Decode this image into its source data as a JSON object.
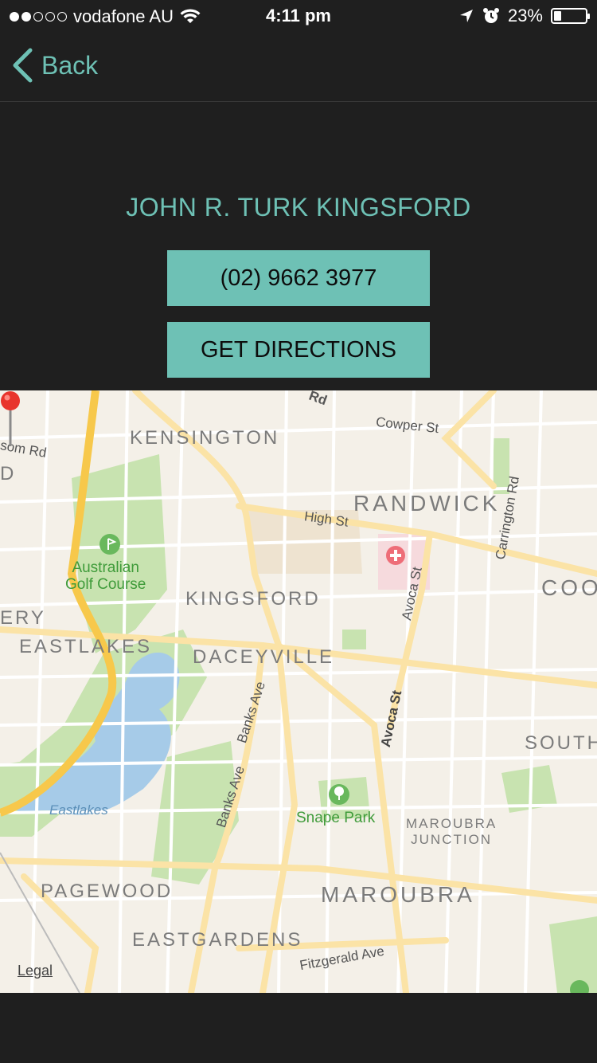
{
  "status_bar": {
    "carrier": "vodafone AU",
    "time": "4:11 pm",
    "battery": "23%",
    "battery_level": 0.23,
    "signal_bars_filled": 2,
    "signal_bars_total": 5
  },
  "nav": {
    "back_label": "Back"
  },
  "place": {
    "name": "JOHN R. TURK KINGSFORD",
    "phone": "(02) 9662 3977",
    "directions_label": "GET DIRECTIONS"
  },
  "map": {
    "suburbs": {
      "kensington": "KENSINGTON",
      "randwick": "RANDWICK",
      "kingsford": "KINGSFORD",
      "daceyville": "DACEYVILLE",
      "eastlakes": "EASTLAKES",
      "pagewood": "PAGEWOOD",
      "eastgardens": "EASTGARDENS",
      "maroubra": "MAROUBRA",
      "maroubra_junction_1": "MAROUBRA",
      "maroubra_junction_2": "JUNCTION",
      "south": "SOUTH",
      "coogee_partial": "COO",
      "ery_partial": "ERY",
      "d_partial": "D"
    },
    "streets": {
      "cowper": "Cowper St",
      "high": "High St",
      "carrington": "Carrington Rd",
      "avoca_upper": "Avoca St",
      "avoca_lower": "Avoca St",
      "banks_1": "Banks Ave",
      "banks_2": "Banks Ave",
      "fitzgerald": "Fitzgerald Ave",
      "anzac_partial": "Rd",
      "som_rd_partial": "som Rd"
    },
    "parks": {
      "golf_1": "Australian",
      "golf_2": "Golf Course",
      "snape": "Snape Park"
    },
    "water": {
      "eastlakes": "Eastlakes"
    },
    "legal": "Legal"
  }
}
